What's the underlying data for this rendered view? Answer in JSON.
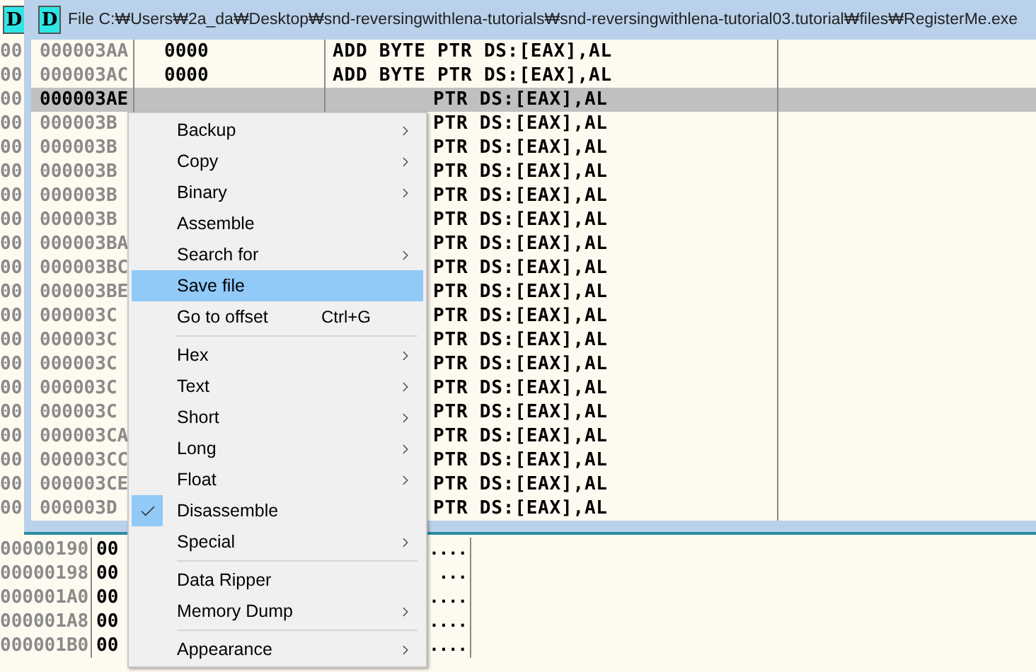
{
  "back_window": {
    "badge": "D",
    "strip_rows": [
      "00",
      "00",
      "00",
      "00",
      "00",
      "00",
      "00",
      "00",
      "00",
      "00",
      "00",
      "00",
      "00",
      "00",
      "00",
      "00",
      "00",
      "00",
      "00",
      "00"
    ],
    "rows": [
      {
        "address": "00000190",
        "hex": "00",
        "ascii": "...."
      },
      {
        "address": "00000198",
        "hex": "00",
        "ascii": "..."
      },
      {
        "address": "000001A0",
        "hex": "00",
        "ascii": "...."
      },
      {
        "address": "000001A8",
        "hex": "00",
        "ascii": "...."
      },
      {
        "address": "000001B0",
        "hex": "00",
        "ascii": "...."
      }
    ]
  },
  "window": {
    "badge": "D",
    "title": "File C:₩Users₩2a_da₩Desktop₩snd-reversingwithlena-tutorials₩snd-reversingwithlena-tutorial03.tutorial₩files₩RegisterMe.exe"
  },
  "rows": [
    {
      "address": "000003AA",
      "hex": "0000",
      "disasm": "ADD BYTE PTR DS:[EAX],AL",
      "selected": false
    },
    {
      "address": "000003AC",
      "hex": "0000",
      "disasm": "ADD BYTE PTR DS:[EAX],AL",
      "selected": false
    },
    {
      "address": "000003AE",
      "disasm": "PTR DS:[EAX],AL",
      "selected": true
    },
    {
      "address": "000003B",
      "disasm": "PTR DS:[EAX],AL",
      "selected": false
    },
    {
      "address": "000003B",
      "disasm": "PTR DS:[EAX],AL",
      "selected": false
    },
    {
      "address": "000003B",
      "disasm": "PTR DS:[EAX],AL",
      "selected": false
    },
    {
      "address": "000003B",
      "disasm": "PTR DS:[EAX],AL",
      "selected": false
    },
    {
      "address": "000003B",
      "disasm": "PTR DS:[EAX],AL",
      "selected": false
    },
    {
      "address": "000003BA",
      "disasm": "PTR DS:[EAX],AL",
      "selected": false
    },
    {
      "address": "000003BC",
      "disasm": "PTR DS:[EAX],AL",
      "selected": false
    },
    {
      "address": "000003BE",
      "disasm": "PTR DS:[EAX],AL",
      "selected": false
    },
    {
      "address": "000003C",
      "disasm": "PTR DS:[EAX],AL",
      "selected": false
    },
    {
      "address": "000003C",
      "disasm": "PTR DS:[EAX],AL",
      "selected": false
    },
    {
      "address": "000003C",
      "disasm": "PTR DS:[EAX],AL",
      "selected": false
    },
    {
      "address": "000003C",
      "disasm": "PTR DS:[EAX],AL",
      "selected": false
    },
    {
      "address": "000003C",
      "disasm": "PTR DS:[EAX],AL",
      "selected": false
    },
    {
      "address": "000003CA",
      "disasm": "PTR DS:[EAX],AL",
      "selected": false
    },
    {
      "address": "000003CC",
      "disasm": "PTR DS:[EAX],AL",
      "selected": false
    },
    {
      "address": "000003CE",
      "disasm": "PTR DS:[EAX],AL",
      "selected": false
    },
    {
      "address": "000003D",
      "disasm": "PTR DS:[EAX],AL",
      "selected": false
    }
  ],
  "menu": {
    "groups": [
      [
        {
          "label": "Backup",
          "submenu": true,
          "checked": false,
          "selected": false
        },
        {
          "label": "Copy",
          "submenu": true,
          "checked": false,
          "selected": false
        },
        {
          "label": "Binary",
          "submenu": true,
          "checked": false,
          "selected": false
        },
        {
          "label": "Assemble",
          "submenu": false,
          "checked": false,
          "selected": false
        },
        {
          "label": "Search for",
          "submenu": true,
          "checked": false,
          "selected": false
        },
        {
          "label": "Save file",
          "submenu": false,
          "checked": false,
          "selected": true
        },
        {
          "label": "Go to offset",
          "shortcut": "Ctrl+G",
          "submenu": false,
          "checked": false,
          "selected": false
        }
      ],
      [
        {
          "label": "Hex",
          "submenu": true,
          "checked": false,
          "selected": false
        },
        {
          "label": "Text",
          "submenu": true,
          "checked": false,
          "selected": false
        },
        {
          "label": "Short",
          "submenu": true,
          "checked": false,
          "selected": false
        },
        {
          "label": "Long",
          "submenu": true,
          "checked": false,
          "selected": false
        },
        {
          "label": "Float",
          "submenu": true,
          "checked": false,
          "selected": false
        },
        {
          "label": "Disassemble",
          "submenu": false,
          "checked": true,
          "selected": false
        },
        {
          "label": "Special",
          "submenu": true,
          "checked": false,
          "selected": false
        }
      ],
      [
        {
          "label": "Data Ripper",
          "submenu": false,
          "checked": false,
          "selected": false
        },
        {
          "label": "Memory Dump",
          "submenu": true,
          "checked": false,
          "selected": false
        }
      ],
      [
        {
          "label": "Appearance",
          "submenu": true,
          "checked": false,
          "selected": false
        }
      ]
    ]
  }
}
